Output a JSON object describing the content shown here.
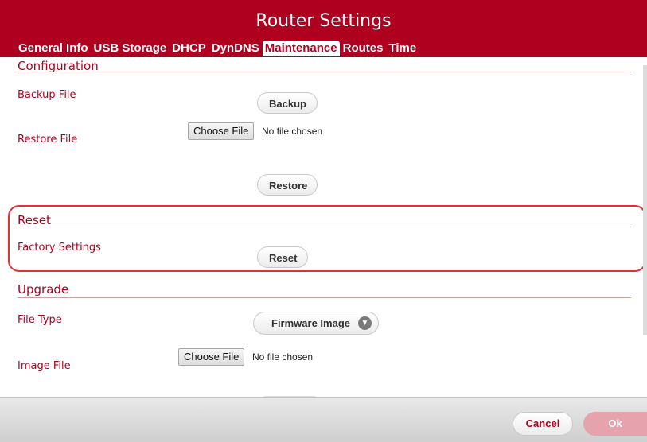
{
  "window": {
    "title": "Router Settings"
  },
  "tabs": [
    {
      "label": "General Info"
    },
    {
      "label": "USB Storage"
    },
    {
      "label": "DHCP"
    },
    {
      "label": "DynDNS"
    },
    {
      "label": "Maintenance"
    },
    {
      "label": "Routes"
    },
    {
      "label": "Time"
    }
  ],
  "active_tab": "Maintenance",
  "configuration": {
    "title": "Configuration",
    "backup_label": "Backup File",
    "backup_button": "Backup",
    "restore_label": "Restore File",
    "restore_file_button": "Choose File",
    "restore_file_status": "No file chosen",
    "restore_button": "Restore"
  },
  "reset": {
    "title": "Reset",
    "factory_label": "Factory Settings",
    "reset_button": "Reset"
  },
  "upgrade": {
    "title": "Upgrade",
    "filetype_label": "File Type",
    "filetype_value": "Firmware Image",
    "image_label": "Image File",
    "image_file_button": "Choose File",
    "image_file_status": "No file chosen"
  },
  "footer": {
    "cancel_button": "Cancel",
    "ok_button": "Ok"
  },
  "colors": {
    "brand": "#b0001f",
    "highlight": "#e0303a"
  }
}
